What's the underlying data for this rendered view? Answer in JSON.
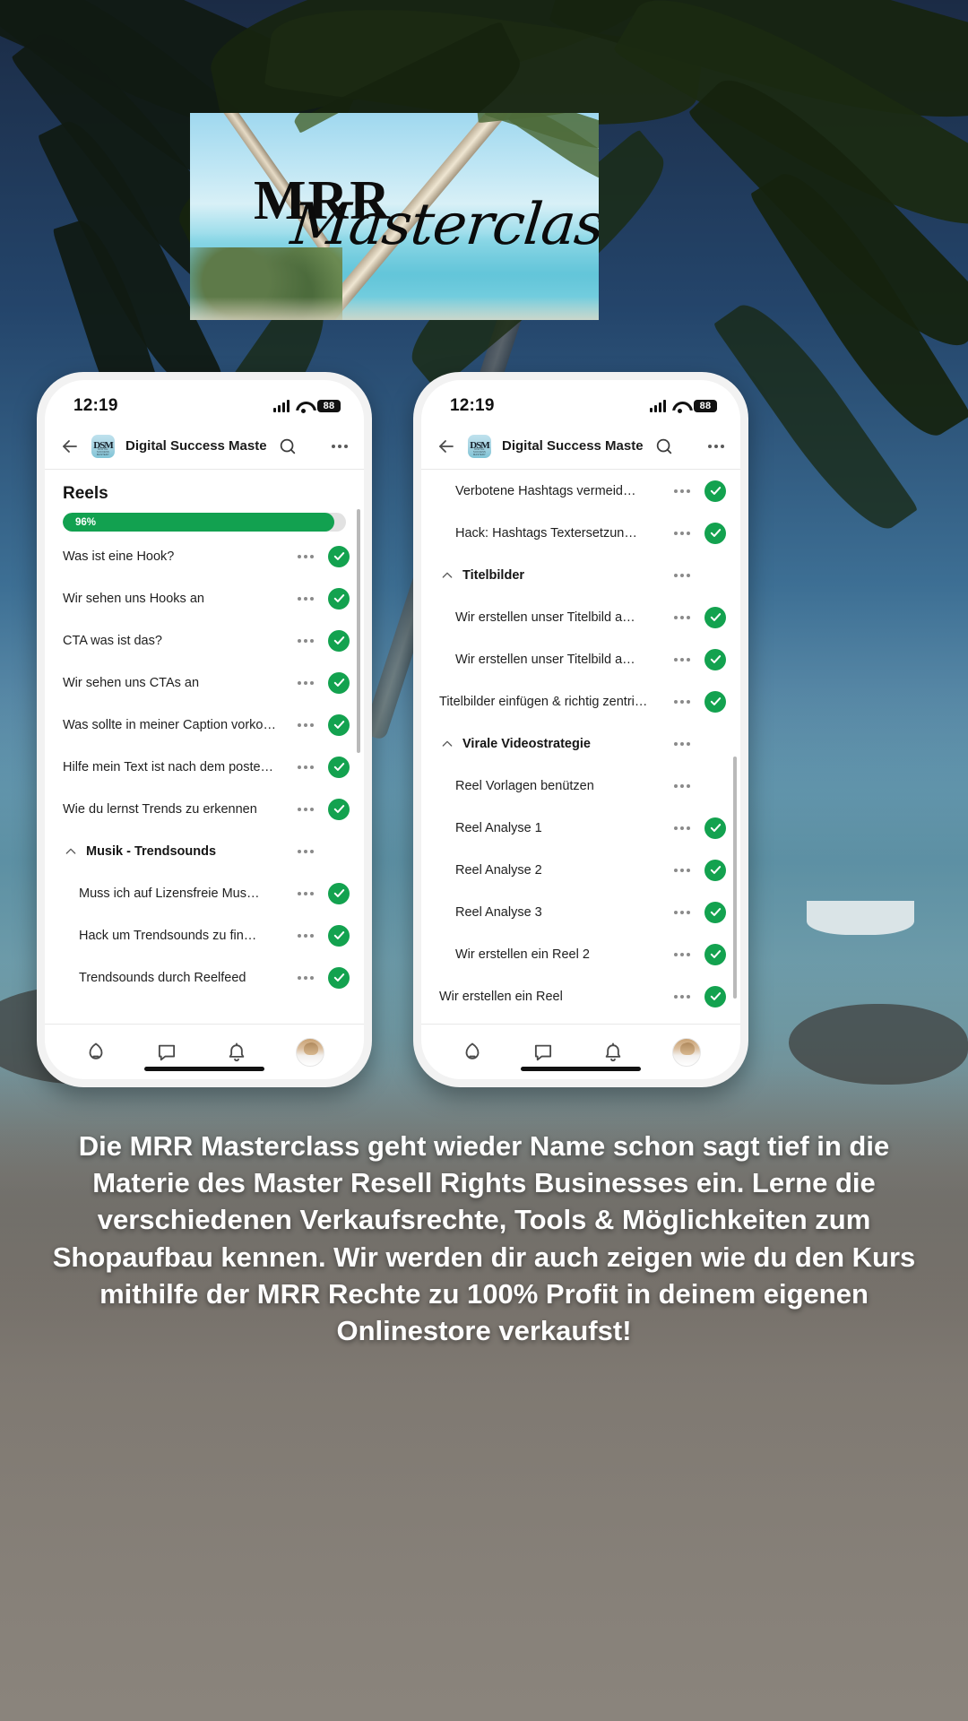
{
  "logo": {
    "line1": "MRR",
    "line2": "Masterclass"
  },
  "caption": "Die MRR Masterclass geht wieder Name schon sagt tief in die Materie des Master Resell Rights Businesses ein. Lerne die verschiedenen Verkaufsrechte, Tools & Möglichkeiten zum Shopaufbau kennen. Wir werden dir auch zeigen wie du den Kurs mithilfe der MRR Rechte zu 100% Profit in deinem eigenen Onlinestore verkaufst!",
  "colors": {
    "accent_green": "#12a150",
    "check_green": "#13a24f",
    "track_grey": "#e2e2e2"
  },
  "phones": [
    {
      "status": {
        "time": "12:19",
        "battery": "88"
      },
      "appbar": {
        "back_icon": "back-arrow-icon",
        "avatar_mono": "DSM",
        "avatar_caption": "DIGITAL SUCCESS MASTERY",
        "title": "Digital Success Mastery",
        "search_icon": "search-icon",
        "more_icon": "more-horizontal-icon"
      },
      "section_title": "Reels",
      "progress": {
        "percent": 96,
        "label": "96%"
      },
      "items": [
        {
          "type": "item",
          "label": "Was ist eine Hook?",
          "done": true
        },
        {
          "type": "item",
          "label": "Wir sehen uns Hooks an",
          "done": true
        },
        {
          "type": "item",
          "label": "CTA was ist das?",
          "done": true
        },
        {
          "type": "item",
          "label": "Wir sehen uns CTAs an",
          "done": true
        },
        {
          "type": "item",
          "label": "Was sollte in meiner Caption vorko…",
          "done": true
        },
        {
          "type": "item",
          "label": "Hilfe mein Text ist nach dem poste…",
          "done": true
        },
        {
          "type": "item",
          "label": "Wie du lernst Trends zu erkennen",
          "done": true
        },
        {
          "type": "section",
          "label": "Musik - Trendsounds",
          "done": false
        },
        {
          "type": "sub",
          "label": "Muss ich auf Lizensfreie Mus…",
          "done": true
        },
        {
          "type": "sub",
          "label": "Hack um Trendsounds zu fin…",
          "done": true
        },
        {
          "type": "sub",
          "label": "Trendsounds durch Reelfeed",
          "done": true
        }
      ],
      "nav": [
        {
          "icon": "home-icon"
        },
        {
          "icon": "chat-bubble-icon"
        },
        {
          "icon": "bell-icon"
        },
        {
          "icon": "profile-avatar"
        }
      ]
    },
    {
      "status": {
        "time": "12:19",
        "battery": "88"
      },
      "appbar": {
        "back_icon": "back-arrow-icon",
        "avatar_mono": "DSM",
        "avatar_caption": "DIGITAL SUCCESS MASTERY",
        "title": "Digital Success Mastery",
        "search_icon": "search-icon",
        "more_icon": "more-horizontal-icon"
      },
      "items": [
        {
          "type": "sub",
          "label": "Verbotene Hashtags vermeid…",
          "done": true
        },
        {
          "type": "sub",
          "label": "Hack: Hashtags Textersetzun…",
          "done": true
        },
        {
          "type": "section",
          "label": "Titelbilder",
          "done": false
        },
        {
          "type": "sub",
          "label": "Wir erstellen unser Titelbild a…",
          "done": true
        },
        {
          "type": "sub",
          "label": "Wir erstellen unser Titelbild a…",
          "done": true
        },
        {
          "type": "item",
          "label": "Titelbilder einfügen & richtig zentri…",
          "done": true
        },
        {
          "type": "section",
          "label": "Virale Videostrategie",
          "done": false
        },
        {
          "type": "sub",
          "label": "Reel Vorlagen benützen",
          "done": false
        },
        {
          "type": "sub",
          "label": "Reel Analyse 1",
          "done": true
        },
        {
          "type": "sub",
          "label": "Reel Analyse 2",
          "done": true
        },
        {
          "type": "sub",
          "label": "Reel Analyse 3",
          "done": true
        },
        {
          "type": "sub",
          "label": "Wir erstellen ein Reel 2",
          "done": true
        },
        {
          "type": "item",
          "label": "Wir erstellen ein Reel",
          "done": true
        }
      ],
      "nav": [
        {
          "icon": "home-icon"
        },
        {
          "icon": "chat-bubble-icon"
        },
        {
          "icon": "bell-icon"
        },
        {
          "icon": "profile-avatar"
        }
      ]
    }
  ]
}
